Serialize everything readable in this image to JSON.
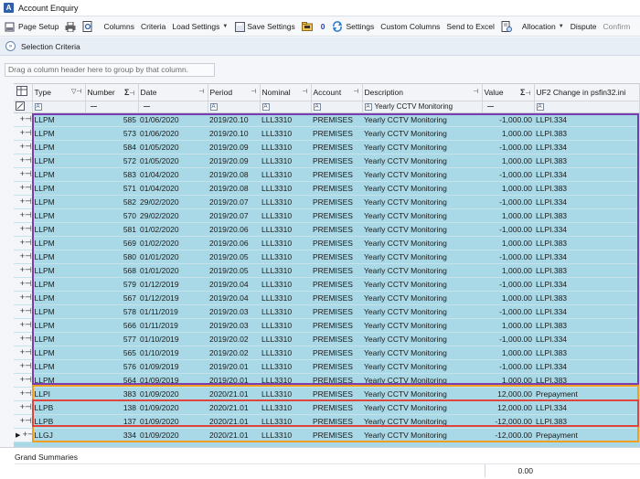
{
  "window": {
    "title": "Account Enquiry"
  },
  "toolbar": {
    "items": [
      {
        "label": "Page Setup",
        "icon": "page-setup-icon"
      },
      {
        "label": "",
        "icon": "print-icon"
      },
      {
        "label": "",
        "icon": "print-preview-icon"
      },
      {
        "label": "Columns",
        "icon": ""
      },
      {
        "label": "Criteria",
        "icon": ""
      },
      {
        "label": "Load Settings",
        "icon": "",
        "dropdown": true
      },
      {
        "label": "Save Settings",
        "icon": "save-settings-icon"
      },
      {
        "label": "",
        "icon": "folder-icon"
      },
      {
        "label": "0",
        "icon": ""
      },
      {
        "label": "Settings",
        "icon": "settings-icon"
      },
      {
        "label": "Custom Columns",
        "icon": ""
      },
      {
        "label": "Send to Excel",
        "icon": ""
      },
      {
        "label": "",
        "icon": "report-icon"
      },
      {
        "label": "Allocation",
        "icon": "",
        "dropdown": true
      },
      {
        "label": "Dispute",
        "icon": ""
      },
      {
        "label": "Confirm",
        "icon": "",
        "disabled": true
      }
    ]
  },
  "selection_criteria": {
    "label": "Selection Criteria"
  },
  "group_hint": "Drag a column header here to group by that column.",
  "columns": [
    "Type",
    "Number",
    "Date",
    "Period",
    "Nominal",
    "Account",
    "Description",
    "Value",
    "UF2 Change in psfin32.ini"
  ],
  "filter_row": {
    "description": "Yearly CCTV Monitoring"
  },
  "rows": [
    [
      "LLPM",
      "585",
      "01/06/2020",
      "2019/20.10",
      "LLL3310",
      "PREMISES",
      "Yearly CCTV Monitoring",
      "-1,000.00",
      "LLPI.334"
    ],
    [
      "LLPM",
      "573",
      "01/06/2020",
      "2019/20.10",
      "LLL3310",
      "PREMISES",
      "Yearly CCTV Monitoring",
      "1,000.00",
      "LLPI.383"
    ],
    [
      "LLPM",
      "584",
      "01/05/2020",
      "2019/20.09",
      "LLL3310",
      "PREMISES",
      "Yearly CCTV Monitoring",
      "-1,000.00",
      "LLPI.334"
    ],
    [
      "LLPM",
      "572",
      "01/05/2020",
      "2019/20.09",
      "LLL3310",
      "PREMISES",
      "Yearly CCTV Monitoring",
      "1,000.00",
      "LLPI.383"
    ],
    [
      "LLPM",
      "583",
      "01/04/2020",
      "2019/20.08",
      "LLL3310",
      "PREMISES",
      "Yearly CCTV Monitoring",
      "-1,000.00",
      "LLPI.334"
    ],
    [
      "LLPM",
      "571",
      "01/04/2020",
      "2019/20.08",
      "LLL3310",
      "PREMISES",
      "Yearly CCTV Monitoring",
      "1,000.00",
      "LLPI.383"
    ],
    [
      "LLPM",
      "582",
      "29/02/2020",
      "2019/20.07",
      "LLL3310",
      "PREMISES",
      "Yearly CCTV Monitoring",
      "-1,000.00",
      "LLPI.334"
    ],
    [
      "LLPM",
      "570",
      "29/02/2020",
      "2019/20.07",
      "LLL3310",
      "PREMISES",
      "Yearly CCTV Monitoring",
      "1,000.00",
      "LLPI.383"
    ],
    [
      "LLPM",
      "581",
      "01/02/2020",
      "2019/20.06",
      "LLL3310",
      "PREMISES",
      "Yearly CCTV Monitoring",
      "-1,000.00",
      "LLPI.334"
    ],
    [
      "LLPM",
      "569",
      "01/02/2020",
      "2019/20.06",
      "LLL3310",
      "PREMISES",
      "Yearly CCTV Monitoring",
      "1,000.00",
      "LLPI.383"
    ],
    [
      "LLPM",
      "580",
      "01/01/2020",
      "2019/20.05",
      "LLL3310",
      "PREMISES",
      "Yearly CCTV Monitoring",
      "-1,000.00",
      "LLPI.334"
    ],
    [
      "LLPM",
      "568",
      "01/01/2020",
      "2019/20.05",
      "LLL3310",
      "PREMISES",
      "Yearly CCTV Monitoring",
      "1,000.00",
      "LLPI.383"
    ],
    [
      "LLPM",
      "579",
      "01/12/2019",
      "2019/20.04",
      "LLL3310",
      "PREMISES",
      "Yearly CCTV Monitoring",
      "-1,000.00",
      "LLPI.334"
    ],
    [
      "LLPM",
      "567",
      "01/12/2019",
      "2019/20.04",
      "LLL3310",
      "PREMISES",
      "Yearly CCTV Monitoring",
      "1,000.00",
      "LLPI.383"
    ],
    [
      "LLPM",
      "578",
      "01/11/2019",
      "2019/20.03",
      "LLL3310",
      "PREMISES",
      "Yearly CCTV Monitoring",
      "-1,000.00",
      "LLPI.334"
    ],
    [
      "LLPM",
      "566",
      "01/11/2019",
      "2019/20.03",
      "LLL3310",
      "PREMISES",
      "Yearly CCTV Monitoring",
      "1,000.00",
      "LLPI.383"
    ],
    [
      "LLPM",
      "577",
      "01/10/2019",
      "2019/20.02",
      "LLL3310",
      "PREMISES",
      "Yearly CCTV Monitoring",
      "-1,000.00",
      "LLPI.334"
    ],
    [
      "LLPM",
      "565",
      "01/10/2019",
      "2019/20.02",
      "LLL3310",
      "PREMISES",
      "Yearly CCTV Monitoring",
      "1,000.00",
      "LLPI.383"
    ],
    [
      "LLPM",
      "576",
      "01/09/2019",
      "2019/20.01",
      "LLL3310",
      "PREMISES",
      "Yearly CCTV Monitoring",
      "-1,000.00",
      "LLPI.334"
    ],
    [
      "LLPM",
      "564",
      "01/09/2019",
      "2019/20.01",
      "LLL3310",
      "PREMISES",
      "Yearly CCTV Monitoring",
      "1,000.00",
      "LLPI.383"
    ],
    [
      "LLPI",
      "383",
      "01/09/2020",
      "2020/21.01",
      "LLL3310",
      "PREMISES",
      "Yearly CCTV Monitoring",
      "12,000.00",
      "Prepayment"
    ],
    [
      "LLPB",
      "138",
      "01/09/2020",
      "2020/21.01",
      "LLL3310",
      "PREMISES",
      "Yearly CCTV Monitoring",
      "12,000.00",
      "LLPI.334"
    ],
    [
      "LLPB",
      "137",
      "01/09/2020",
      "2020/21.01",
      "LLL3310",
      "PREMISES",
      "Yearly CCTV Monitoring",
      "-12,000.00",
      "LLPI.383"
    ],
    [
      "LLGJ",
      "334",
      "01/09/2020",
      "2020/21.01",
      "LLL3310",
      "PREMISES",
      "Yearly CCTV Monitoring",
      "-12,000.00",
      "Prepayment"
    ]
  ],
  "footer": {
    "label": "Grand Summaries",
    "value_total": "0.00"
  },
  "colors": {
    "row_bg": "#a9d9e6",
    "purple_frame": "#7a3db0",
    "red_frame": "#e0443a",
    "orange_frame": "#f0a020"
  }
}
